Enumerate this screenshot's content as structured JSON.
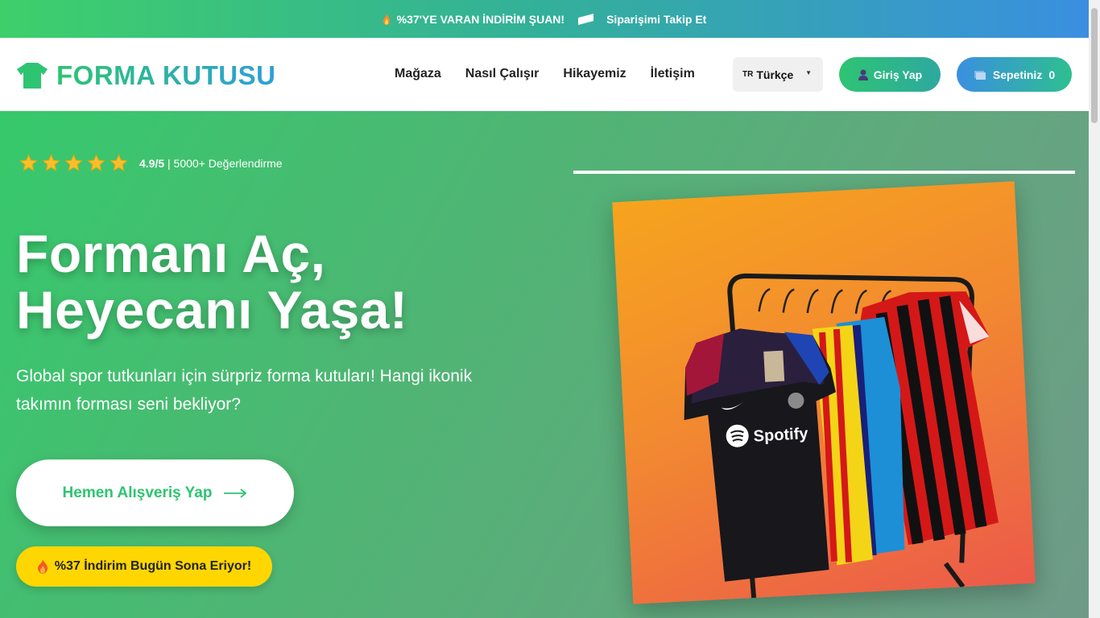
{
  "topbar": {
    "promo_text": "%37'YE VARAN İNDİRİM ŞUAN!",
    "track_order": "Siparişimi Takip Et"
  },
  "header": {
    "logo": "FORMA KUTUSU",
    "nav": [
      "Mağaza",
      "Nasıl Çalışır",
      "Hikayemiz",
      "İletişim"
    ],
    "language_code": "TR",
    "language": "Türkçe",
    "login": "Giriş Yap",
    "cart_label": "Sepetiniz",
    "cart_count": "0"
  },
  "hero": {
    "rating_score": "4.9/5",
    "rating_count": "| 5000+ Değerlendirme",
    "stars": 5,
    "headline_line1": "Formanı Aç,",
    "headline_line2": "Heyecanı Yaşa!",
    "subtitle": "Global spor tutkunları için sürpriz forma kutuları! Hangi ikonik takımın forması seni bekliyor?",
    "cta": "Hemen Alışveriş Yap",
    "sale_badge": "%37 İndirim Bugün Sona Eriyor!",
    "jersey_sponsor": "Spotify"
  },
  "colors": {
    "brand_green": "#2ec472",
    "brand_blue": "#3a8fe0",
    "badge_yellow": "#ffd600"
  }
}
